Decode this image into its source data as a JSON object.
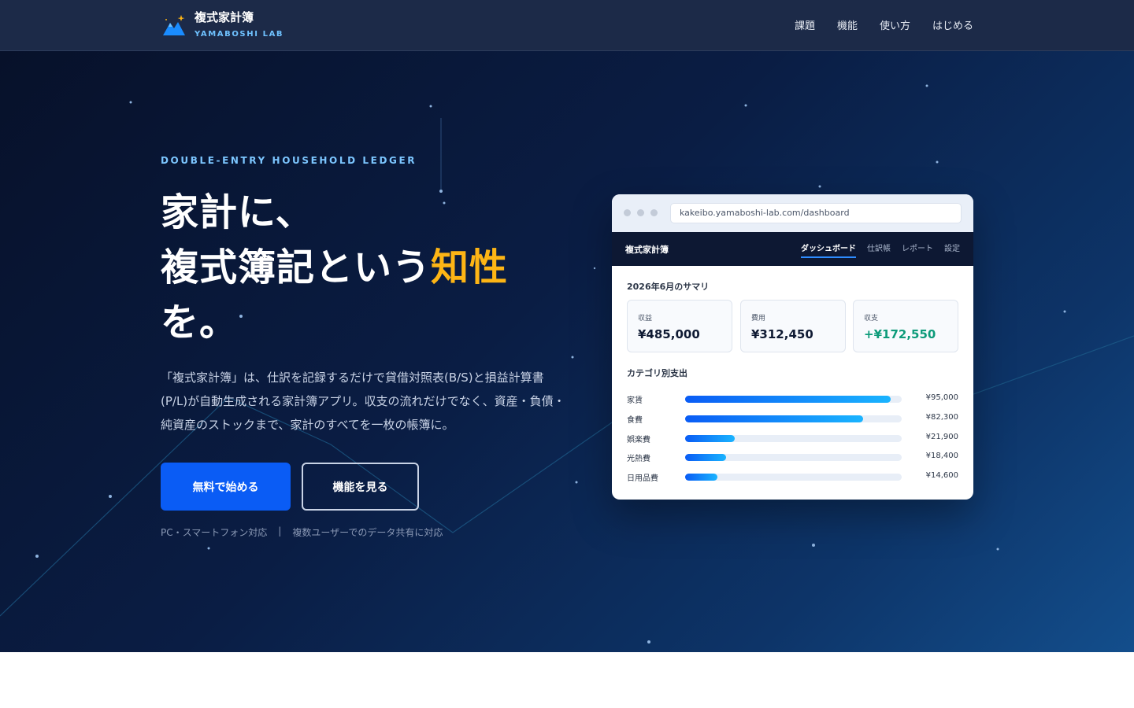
{
  "header": {
    "brand_title": "複式家計簿",
    "brand_sub": "YAMABOSHI LAB",
    "nav": [
      {
        "label": "課題"
      },
      {
        "label": "機能"
      },
      {
        "label": "使い方"
      },
      {
        "label": "はじめる"
      }
    ]
  },
  "hero": {
    "eyebrow": "DOUBLE-ENTRY HOUSEHOLD LEDGER",
    "headline_1": "家計に、",
    "headline_2a": "複式簿記という",
    "headline_2b": "知性",
    "headline_3": "を。",
    "lead": "「複式家計簿」は、仕訳を記録するだけで貸借対照表(B/S)と損益計算書(P/L)が自動生成される家計簿アプリ。収支の流れだけでなく、資産・負債・純資産のストックまで、家計のすべてを一枚の帳簿に。",
    "primary_cta": "無料で始める",
    "secondary_cta": "機能を見る",
    "footnote_1": "PC・スマートフォン対応",
    "footnote_sep": "|",
    "footnote_2": "複数ユーザーでのデータ共有に対応"
  },
  "mock": {
    "url": "kakeibo.yamaboshi-lab.com/dashboard",
    "brand": "複式家計簿",
    "tabs": [
      {
        "label": "ダッシュボード",
        "active": true
      },
      {
        "label": "仕訳帳"
      },
      {
        "label": "レポート"
      },
      {
        "label": "設定"
      }
    ],
    "summary_title": "2026年6月のサマリ",
    "stats": [
      {
        "label": "収益",
        "value": "¥485,000"
      },
      {
        "label": "費用",
        "value": "¥312,450"
      },
      {
        "label": "収支",
        "value": "+¥172,550"
      }
    ],
    "category_title": "カテゴリ別支出",
    "categories": [
      {
        "label": "家賃",
        "value": "¥95,000",
        "ratio": 0.95
      },
      {
        "label": "食費",
        "value": "¥82,300",
        "ratio": 0.82
      },
      {
        "label": "娯楽費",
        "value": "¥21,900",
        "ratio": 0.23
      },
      {
        "label": "光熱費",
        "value": "¥18,400",
        "ratio": 0.19
      },
      {
        "label": "日用品費",
        "value": "¥14,600",
        "ratio": 0.15
      }
    ]
  },
  "colors": {
    "accent": "#fdb515",
    "primary": "#0a5cf5",
    "positive": "#0d9b7a"
  }
}
